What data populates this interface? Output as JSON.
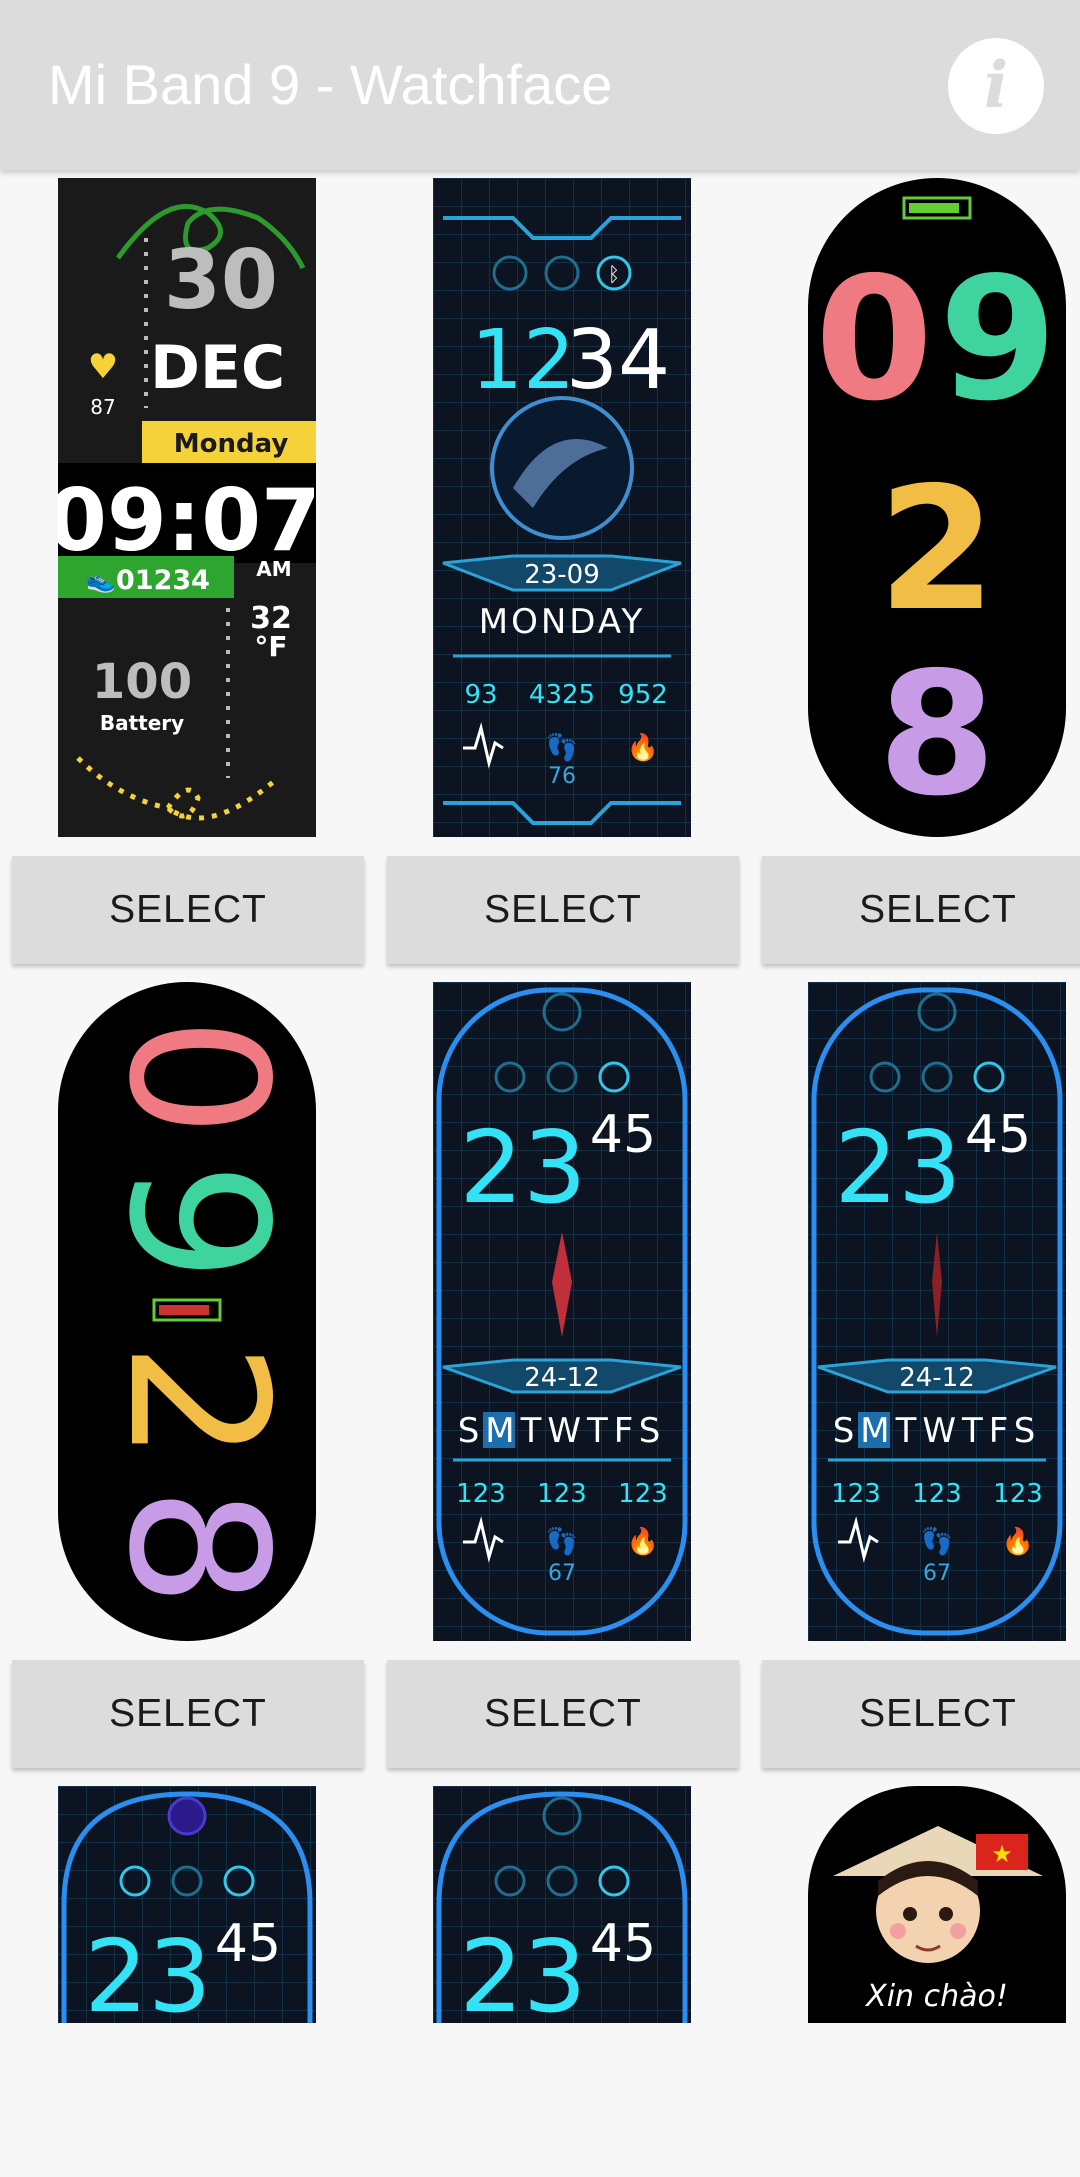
{
  "app": {
    "title": "Mi Band 9 - Watchface",
    "info_icon": "info-icon"
  },
  "select_label": "SELECT",
  "faces": {
    "f1": {
      "day": "30",
      "month": "DEC",
      "heart": "87",
      "weekday": "Monday",
      "time": "09:07",
      "steps": "01234",
      "ampm": "AM",
      "temp": "32",
      "unit": "°F",
      "battery": "100",
      "battery_label": "Battery",
      "accent": "#f5d13a",
      "green": "#2ea52e"
    },
    "f2": {
      "hour": "12",
      "minute": "34",
      "date": "23-09",
      "weekday": "MONDAY",
      "heart": "93",
      "steps": "4325",
      "cal": "952",
      "battery": "76"
    },
    "f3": {
      "hour": "09",
      "minute": "28",
      "colors": [
        "#f07a82",
        "#3fd3a0",
        "#f2bd45",
        "#c79be6"
      ]
    },
    "f4": {
      "digits": "0928",
      "colors": [
        "#f07a82",
        "#3fd3a0",
        "#f2bd45",
        "#c79be6"
      ]
    },
    "f5": {
      "hour": "23",
      "minute": "45",
      "date": "24-12",
      "weekdays": "SMTWTFS",
      "heart": "123",
      "steps": "123",
      "cal": "123",
      "battery": "67"
    },
    "f6": {
      "hour": "23",
      "minute": "45",
      "date": "24-12",
      "weekdays": "SMTWTFS",
      "heart": "123",
      "steps": "123",
      "cal": "123",
      "battery": "67"
    },
    "f7": {
      "hour": "23",
      "minute": "45"
    },
    "f8": {
      "hour": "23",
      "minute": "45"
    },
    "f9": {
      "greeting": "Xin chào!"
    }
  }
}
